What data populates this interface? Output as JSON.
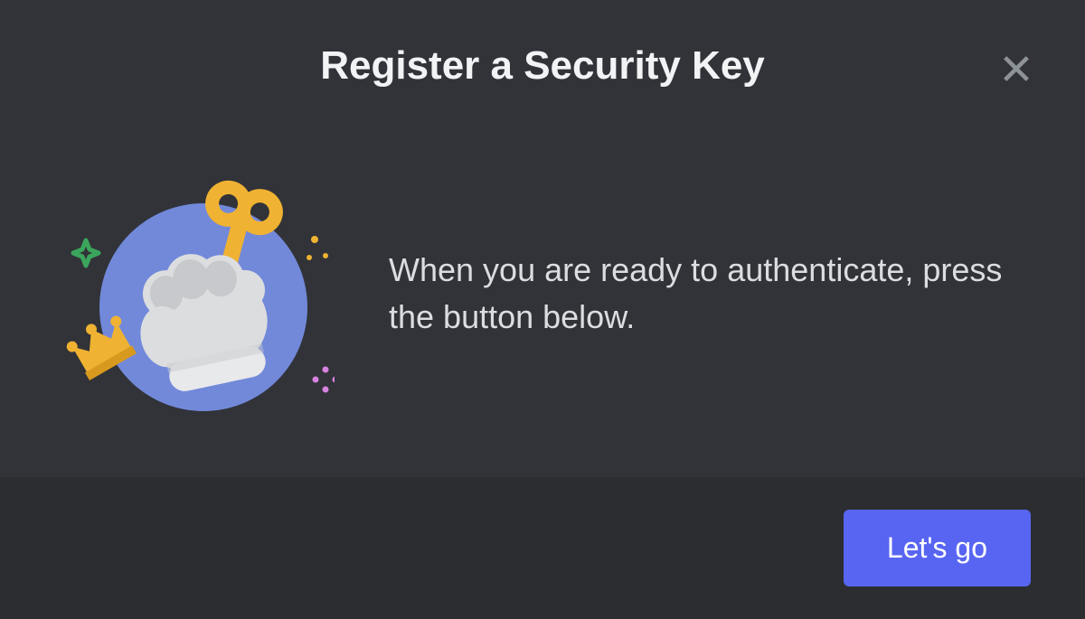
{
  "modal": {
    "title": "Register a Security Key",
    "description": "When you are ready to authenticate, press the button below.",
    "primary_button_label": "Let's go"
  }
}
